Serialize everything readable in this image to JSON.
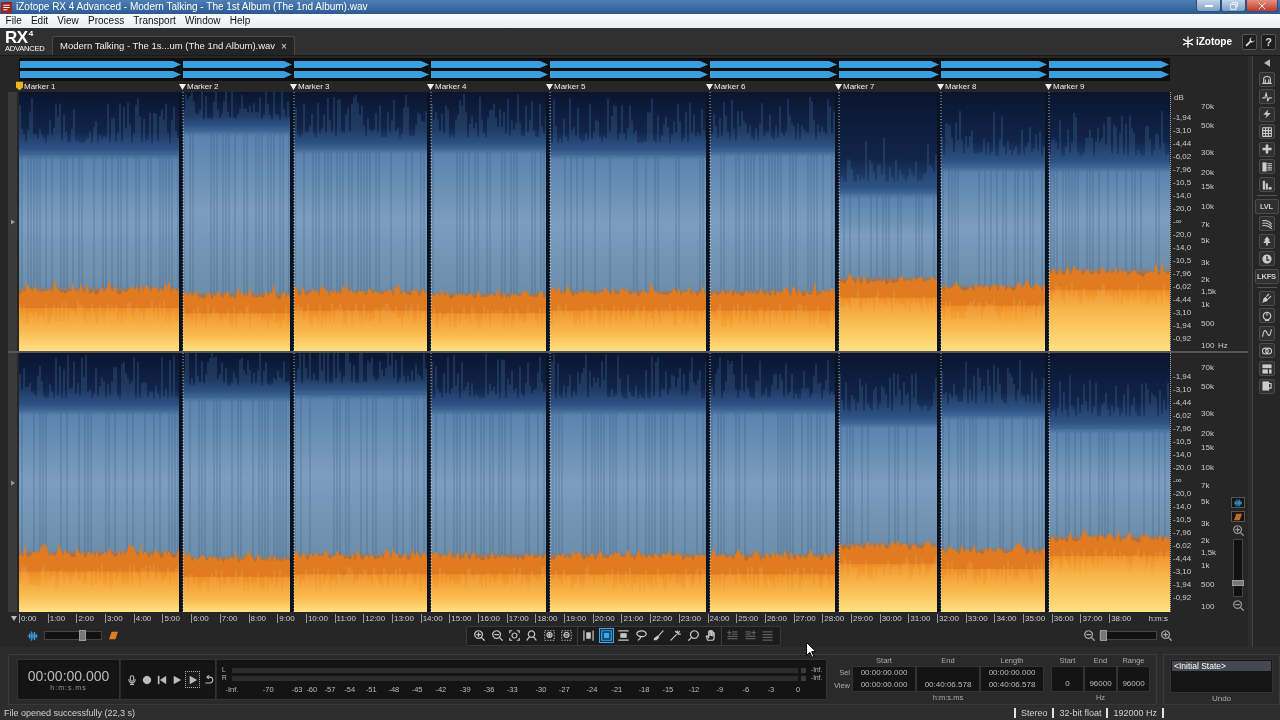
{
  "window": {
    "title": "iZotope RX 4 Advanced - Modern Talking - The 1st Album (The 1nd Album).wav"
  },
  "menu": [
    "File",
    "Edit",
    "View",
    "Process",
    "Transport",
    "Window",
    "Help"
  ],
  "logo": {
    "name": "RX",
    "version": "4",
    "edition": "ADVANCED"
  },
  "tabs": [
    {
      "label": "Modern Talking - The 1s...um (The 1nd Album).wav",
      "close": "×",
      "selected": true
    }
  ],
  "brand": "iZotope",
  "help_button": "?",
  "markers": [
    {
      "label": "Marker 1"
    },
    {
      "label": "Marker 2"
    },
    {
      "label": "Marker 3"
    },
    {
      "label": "Marker 4"
    },
    {
      "label": "Marker 5"
    },
    {
      "label": "Marker 6"
    },
    {
      "label": "Marker 7"
    },
    {
      "label": "Marker 8"
    },
    {
      "label": "Marker 9"
    }
  ],
  "channels": [
    {
      "db_unit": "dB",
      "db_labels": [
        "-1,94",
        "-3,10",
        "-4,44",
        "-6,02",
        "-7,96",
        "-10,5",
        "-14,0",
        "-20,0",
        "-∞",
        "-20,0",
        "-14,0",
        "-10,5",
        "-7,96",
        "-6,02",
        "-4,44",
        "-3,10",
        "-1,94",
        "-0,92"
      ],
      "hz_labels": [
        "70k",
        "50k",
        "30k",
        "20k",
        "15k",
        "10k",
        "7k",
        "5k",
        "3k",
        "2k",
        "1,5k",
        "1k",
        "500",
        "100"
      ],
      "hz_unit": "Hz"
    },
    {
      "db_labels": [
        "-1,94",
        "-3,10",
        "-4,44",
        "-6,02",
        "-7,96",
        "-10,5",
        "-14,0",
        "-20,0",
        "-∞",
        "-20,0",
        "-14,0",
        "-10,5",
        "-7,96",
        "-6,02",
        "-4,44",
        "-3,10",
        "-1,94",
        "-0,92"
      ],
      "hz_labels": [
        "70k",
        "50k",
        "30k",
        "20k",
        "15k",
        "10k",
        "7k",
        "5k",
        "3k",
        "2k",
        "1,5k",
        "1k",
        "500",
        "100"
      ]
    }
  ],
  "time_axis": {
    "labels": [
      "0:00",
      "1:00",
      "2:00",
      "3:00",
      "4:00",
      "5:00",
      "6:00",
      "7:00",
      "8:00",
      "9:00",
      "10:00",
      "11:00",
      "12:00",
      "13:00",
      "14:00",
      "15:00",
      "16:00",
      "17:00",
      "18:00",
      "19:00",
      "20:00",
      "21:00",
      "22:00",
      "23:00",
      "24:00",
      "25:00",
      "26:00",
      "27:00",
      "28:00",
      "29:00",
      "30:00",
      "31:00",
      "32:00",
      "33:00",
      "34:00",
      "35:00",
      "36:00",
      "37:00",
      "38:00"
    ],
    "unit": "h:m:s"
  },
  "view_blend": {
    "level": 0.7
  },
  "selection_tools": [
    {
      "selected": false
    },
    {
      "selected": true
    },
    {
      "selected": false
    },
    {
      "selected": false
    },
    {
      "selected": false
    },
    {
      "selected": false
    },
    {
      "selected": false
    },
    {
      "selected": false
    }
  ],
  "action_tools": [
    {
      "disabled": true
    },
    {
      "disabled": true
    },
    {
      "disabled": true
    }
  ],
  "time_zoom": {
    "level": 0
  },
  "frequency_zoom": {
    "level": 0.2
  },
  "module_bar": {
    "labels": [
      "LVL",
      "LKFS"
    ]
  },
  "time_display": {
    "value": "00:00:00.000",
    "unit": "h:m:s.ms"
  },
  "meter": {
    "channels": [
      {
        "label": "L",
        "peak": "-Inf."
      },
      {
        "label": "R",
        "peak": "-Inf."
      }
    ],
    "scale": [
      "-Inf.",
      "-70",
      "-63",
      "-60",
      "-57",
      "-54",
      "-51",
      "-48",
      "-45",
      "-42",
      "-39",
      "-36",
      "-33",
      "-30",
      "-27",
      "-24",
      "-21",
      "-18",
      "-15",
      "-12",
      "-9",
      "-6",
      "-3",
      "0"
    ]
  },
  "selection": {
    "columns": [
      "Start",
      "End",
      "Length"
    ],
    "rows": [
      {
        "label": "Sel",
        "start": "00:00:00.000",
        "length": "00:00:00.000"
      },
      {
        "label": "View",
        "start": "00:00:00.000",
        "end": "00:40:06.578",
        "length": "00:40:06.578"
      }
    ],
    "unit": "h:m:s.ms"
  },
  "frequency_range": {
    "columns": [
      "Start",
      "End",
      "Range"
    ],
    "values": [
      "0",
      "96000",
      "96000"
    ],
    "unit": "Hz"
  },
  "undo": {
    "items": [
      {
        "label": "<Initial State>",
        "selected": true
      }
    ],
    "title": "Undo"
  },
  "status_bar": {
    "message": "File opened successfully (22,3 s)",
    "fields": [
      "Stereo",
      "32-bit float",
      "192000 Hz"
    ]
  }
}
